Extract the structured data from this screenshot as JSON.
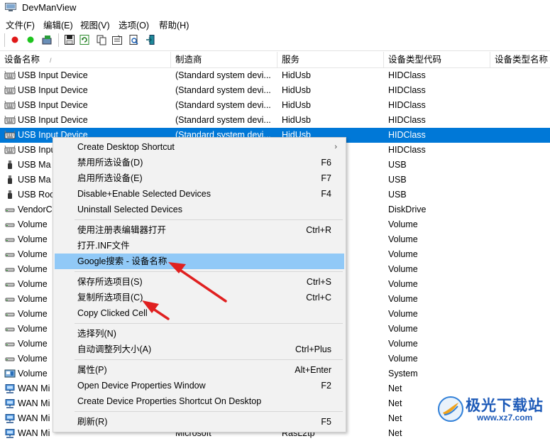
{
  "window": {
    "title": "DevManView"
  },
  "menu": [
    "文件(F)",
    "编辑(E)",
    "视图(V)",
    "选项(O)",
    "帮助(H)"
  ],
  "toolbar": {
    "icons": [
      "red-dot-icon",
      "green-dot-icon",
      "enable-devices-icon",
      "save-icon",
      "refresh-icon",
      "copy-icon",
      "properties-icon",
      "find-icon",
      "exit-icon"
    ]
  },
  "columns": [
    "设备名称",
    "制造商",
    "服务",
    "设备类型代码",
    "设备类型名称"
  ],
  "sort_indicator": "/",
  "rows": [
    {
      "icon": "keyboard",
      "name": "USB Input Device",
      "mfr": "(Standard system devi...",
      "svc": "HidUsb",
      "cls": "HIDClass"
    },
    {
      "icon": "keyboard",
      "name": "USB Input Device",
      "mfr": "(Standard system devi...",
      "svc": "HidUsb",
      "cls": "HIDClass"
    },
    {
      "icon": "keyboard",
      "name": "USB Input Device",
      "mfr": "(Standard system devi...",
      "svc": "HidUsb",
      "cls": "HIDClass"
    },
    {
      "icon": "keyboard",
      "name": "USB Input Device",
      "mfr": "(Standard system devi...",
      "svc": "HidUsb",
      "cls": "HIDClass"
    },
    {
      "icon": "keyboard",
      "name": "USB Input Device",
      "mfr": "(Standard system devi...",
      "svc": "HidUsb",
      "cls": "HIDClass",
      "selected": true
    },
    {
      "icon": "keyboard",
      "name": "USB Inpu",
      "mfr": "",
      "svc": "",
      "cls": "HIDClass"
    },
    {
      "icon": "usb",
      "name": "USB Ma",
      "mfr": "",
      "svc": "",
      "cls": "USB"
    },
    {
      "icon": "usb",
      "name": "USB Ma",
      "mfr": "",
      "svc": "",
      "cls": "USB"
    },
    {
      "icon": "usb",
      "name": "USB Roo",
      "mfr": "",
      "svc": "",
      "cls": "USB"
    },
    {
      "icon": "drive",
      "name": "VendorC",
      "mfr": "",
      "svc": "",
      "cls": "DiskDrive"
    },
    {
      "icon": "drive",
      "name": "Volume",
      "mfr": "",
      "svc": "",
      "cls": "Volume"
    },
    {
      "icon": "drive",
      "name": "Volume",
      "mfr": "",
      "svc": "",
      "cls": "Volume"
    },
    {
      "icon": "drive",
      "name": "Volume",
      "mfr": "",
      "svc": "",
      "cls": "Volume"
    },
    {
      "icon": "drive",
      "name": "Volume",
      "mfr": "",
      "svc": "",
      "cls": "Volume"
    },
    {
      "icon": "drive",
      "name": "Volume",
      "mfr": "",
      "svc": "",
      "cls": "Volume"
    },
    {
      "icon": "drive",
      "name": "Volume",
      "mfr": "",
      "svc": "",
      "cls": "Volume"
    },
    {
      "icon": "drive",
      "name": "Volume",
      "mfr": "",
      "svc": "",
      "cls": "Volume"
    },
    {
      "icon": "drive",
      "name": "Volume",
      "mfr": "",
      "svc": "",
      "cls": "Volume"
    },
    {
      "icon": "drive",
      "name": "Volume",
      "mfr": "",
      "svc": "",
      "cls": "Volume"
    },
    {
      "icon": "drive",
      "name": "Volume",
      "mfr": "",
      "svc": "",
      "cls": "Volume"
    },
    {
      "icon": "system",
      "name": "Volume",
      "mfr": "",
      "svc": "",
      "cls": "System"
    },
    {
      "icon": "network",
      "name": "WAN Mi",
      "mfr": "",
      "svc": "",
      "cls": "Net"
    },
    {
      "icon": "network",
      "name": "WAN Mi",
      "mfr": "",
      "svc": "",
      "cls": "Net"
    },
    {
      "icon": "network",
      "name": "WAN Mi",
      "mfr": "",
      "svc": "",
      "cls": "Net"
    },
    {
      "icon": "network",
      "name": "WAN Mi",
      "mfr": "Microsoft",
      "svc": "RasL2tp",
      "cls": "Net"
    }
  ],
  "context_menu": {
    "groups": [
      [
        {
          "label": "Create Desktop Shortcut",
          "shortcut": "",
          "submenu": true
        },
        {
          "label": "禁用所选设备(D)",
          "shortcut": "F6"
        },
        {
          "label": "启用所选设备(E)",
          "shortcut": "F7"
        },
        {
          "label": "Disable+Enable Selected Devices",
          "shortcut": "F4"
        },
        {
          "label": "Uninstall Selected Devices",
          "shortcut": ""
        }
      ],
      [
        {
          "label": "使用注册表编辑器打开",
          "shortcut": "Ctrl+R"
        },
        {
          "label": "打开.INF文件",
          "shortcut": ""
        },
        {
          "label": "Google搜索 - 设备名称",
          "shortcut": "",
          "highlighted": true
        }
      ],
      [
        {
          "label": "保存所选项目(S)",
          "shortcut": "Ctrl+S"
        },
        {
          "label": "复制所选项目(C)",
          "shortcut": "Ctrl+C"
        },
        {
          "label": "Copy Clicked Cell",
          "shortcut": ""
        }
      ],
      [
        {
          "label": "选择列(N)",
          "shortcut": ""
        },
        {
          "label": "自动调整列大小(A)",
          "shortcut": "Ctrl+Plus"
        }
      ],
      [
        {
          "label": "属性(P)",
          "shortcut": "Alt+Enter"
        },
        {
          "label": "Open Device Properties Window",
          "shortcut": "F2"
        },
        {
          "label": "Create Device Properties Shortcut On Desktop",
          "shortcut": ""
        }
      ],
      [
        {
          "label": "刷新(R)",
          "shortcut": "F5"
        }
      ]
    ]
  },
  "watermark": {
    "text": "极光下载站",
    "url_text": "www.xz7.com"
  },
  "colors": {
    "selection": "#0078d7",
    "menu_highlight": "#91c9f7",
    "annotation_arrow": "#e02020"
  }
}
